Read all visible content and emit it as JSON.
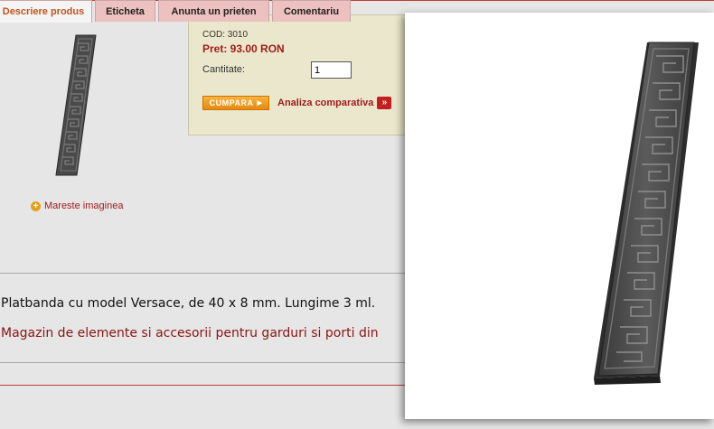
{
  "product": {
    "enlarge_link": "Mareste imaginea",
    "code": "COD: 3010",
    "price": "Pret: 93.00 RON",
    "quantity_label": "Cantitate:",
    "quantity_value": "1",
    "buy_button": "CUMPARA",
    "compare_link": "Analiza comparativa"
  },
  "tabs": [
    {
      "label": "Descriere produs",
      "active": true
    },
    {
      "label": "Eticheta",
      "active": false
    },
    {
      "label": "Anunta un prieten",
      "active": false
    },
    {
      "label": "Comentariu",
      "active": false
    }
  ],
  "description": {
    "text": "Platbanda cu model Versace, de 40 x 8 mm. Lungime 3 ml.",
    "tagline": "Magazin de elemente si accesorii pentru garduri si porti din"
  },
  "colors": {
    "accent_red": "#a11c1c",
    "buy_orange": "#e68a12",
    "price_box": "#eae7cc"
  }
}
